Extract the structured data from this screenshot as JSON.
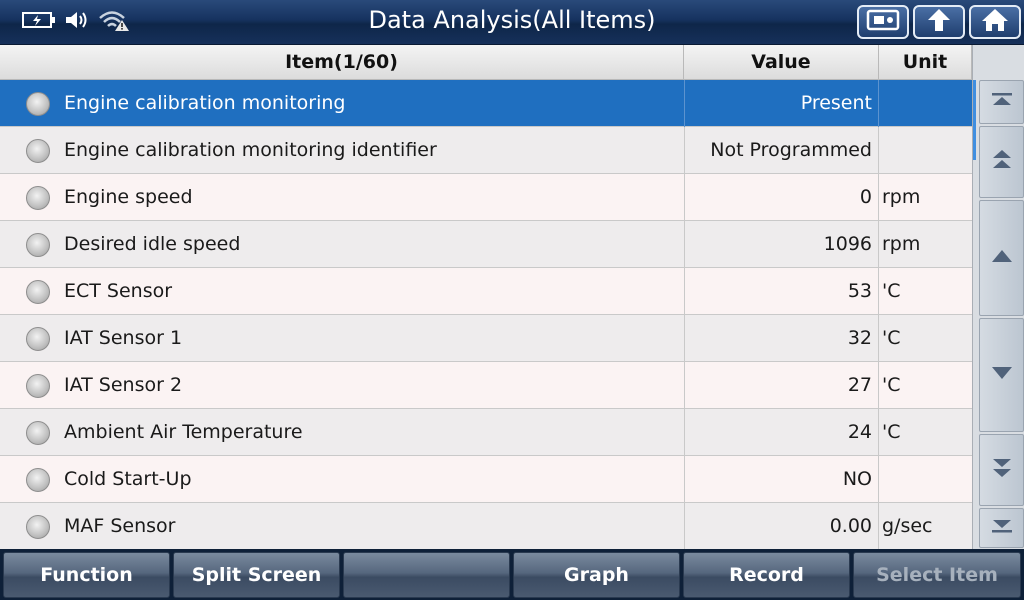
{
  "window": {
    "title": "Data Analysis(All Items)"
  },
  "status_icons": [
    "battery-icon",
    "speaker-icon",
    "wifi-warning-icon"
  ],
  "title_buttons": [
    "screenshot-icon",
    "back-icon",
    "home-icon"
  ],
  "table": {
    "headers": {
      "item": "Item(1/60)",
      "value": "Value",
      "unit": "Unit"
    },
    "rows": [
      {
        "name": "Engine calibration monitoring",
        "value": "Present",
        "unit": "",
        "selected": true
      },
      {
        "name": "Engine calibration monitoring identifier",
        "value": "Not Programmed",
        "unit": ""
      },
      {
        "name": "Engine speed",
        "value": "0",
        "unit": "rpm"
      },
      {
        "name": "Desired idle speed",
        "value": "1096",
        "unit": "rpm"
      },
      {
        "name": "ECT Sensor",
        "value": "53",
        "unit": "'C"
      },
      {
        "name": "IAT Sensor 1",
        "value": "32",
        "unit": "'C"
      },
      {
        "name": "IAT Sensor 2",
        "value": "27",
        "unit": "'C"
      },
      {
        "name": "Ambient Air Temperature",
        "value": "24",
        "unit": "'C"
      },
      {
        "name": "Cold Start-Up",
        "value": "NO",
        "unit": ""
      },
      {
        "name": "MAF Sensor",
        "value": "0.00",
        "unit": "g/sec"
      }
    ]
  },
  "toolbar": {
    "function": "Function",
    "split_screen": "Split Screen",
    "empty": "",
    "graph": "Graph",
    "record": "Record",
    "select_item": "Select Item"
  },
  "colors": {
    "selected_row": "#1f6fc0",
    "titlebar": "#16325f"
  }
}
